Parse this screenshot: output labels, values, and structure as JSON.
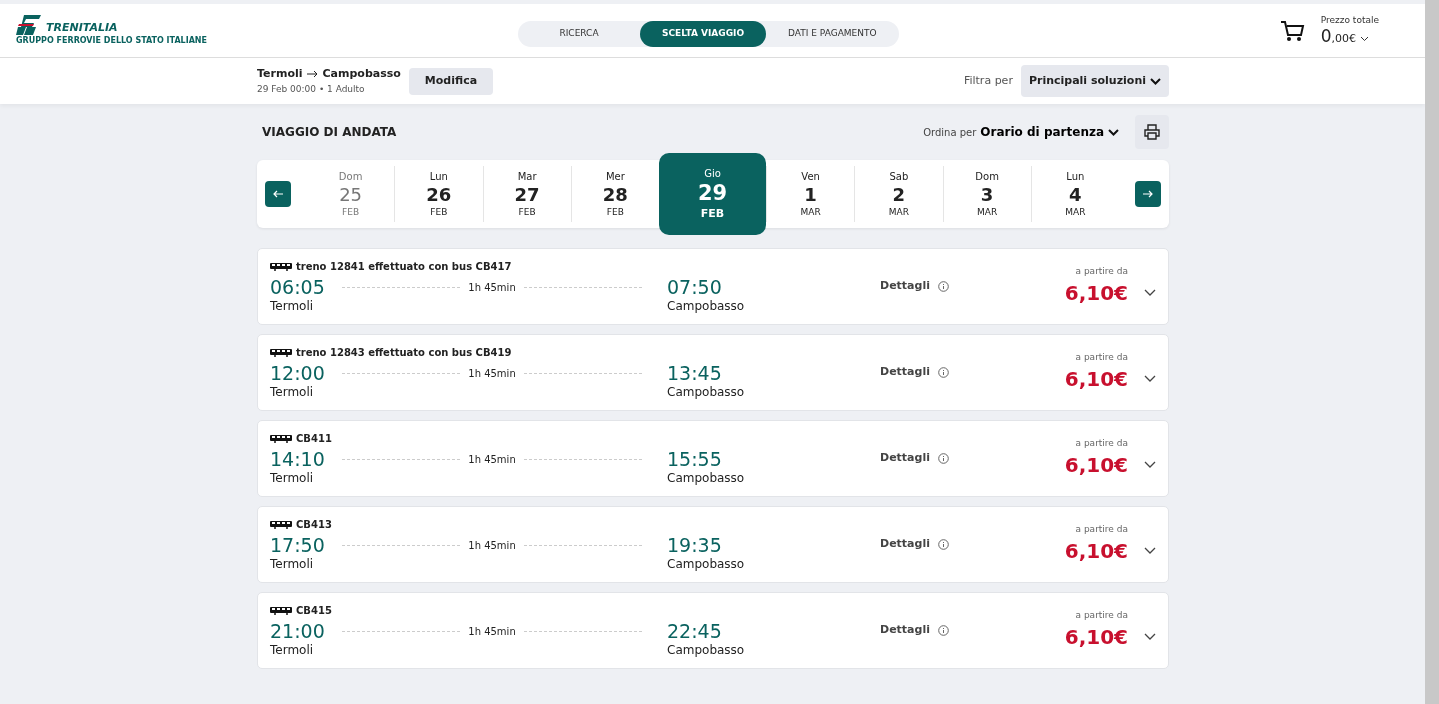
{
  "logo": {
    "name": "TRENITALIA",
    "tagline": "GRUPPO FERROVIE DELLO STATO ITALIANE"
  },
  "steps": [
    {
      "label": "RICERCA",
      "selected": false
    },
    {
      "label": "SCELTA VIAGGIO",
      "selected": true
    },
    {
      "label": "DATI E PAGAMENTO",
      "selected": false
    }
  ],
  "cart": {
    "label": "Prezzo totale",
    "amount_main": "0",
    "amount_cents": ",00€"
  },
  "search_summary": {
    "from": "Termoli",
    "to": "Campobasso",
    "details": "29 Feb 00:00 • 1 Adulto",
    "edit_button": "Modifica"
  },
  "filter": {
    "label": "Filtra per",
    "value": "Principali soluzioni"
  },
  "section_title": "VIAGGIO DI ANDATA",
  "sort": {
    "label": "Ordina per",
    "value": "Orario di partenza"
  },
  "days": [
    {
      "weekday": "Dom",
      "day": "25",
      "month": "FEB",
      "selected": false,
      "disabled": true
    },
    {
      "weekday": "Lun",
      "day": "26",
      "month": "FEB",
      "selected": false,
      "disabled": false
    },
    {
      "weekday": "Mar",
      "day": "27",
      "month": "FEB",
      "selected": false,
      "disabled": false
    },
    {
      "weekday": "Mer",
      "day": "28",
      "month": "FEB",
      "selected": false,
      "disabled": false
    },
    {
      "weekday": "Gio",
      "day": "29",
      "month": "FEB",
      "selected": true,
      "disabled": false
    },
    {
      "weekday": "Ven",
      "day": "1",
      "month": "MAR",
      "selected": false,
      "disabled": false
    },
    {
      "weekday": "Sab",
      "day": "2",
      "month": "MAR",
      "selected": false,
      "disabled": false
    },
    {
      "weekday": "Dom",
      "day": "3",
      "month": "MAR",
      "selected": false,
      "disabled": false
    },
    {
      "weekday": "Lun",
      "day": "4",
      "month": "MAR",
      "selected": false,
      "disabled": false
    }
  ],
  "solutions": [
    {
      "service": "treno 12841 effettuato con bus CB417",
      "departure": "06:05",
      "origin": "Termoli",
      "duration": "1h 45min",
      "arrival": "07:50",
      "destination": "Campobasso",
      "details": "Dettagli",
      "price_label": "a partire da",
      "price": "6,10€"
    },
    {
      "service": "treno 12843 effettuato con bus CB419",
      "departure": "12:00",
      "origin": "Termoli",
      "duration": "1h 45min",
      "arrival": "13:45",
      "destination": "Campobasso",
      "details": "Dettagli",
      "price_label": "a partire da",
      "price": "6,10€"
    },
    {
      "service": "CB411",
      "departure": "14:10",
      "origin": "Termoli",
      "duration": "1h 45min",
      "arrival": "15:55",
      "destination": "Campobasso",
      "details": "Dettagli",
      "price_label": "a partire da",
      "price": "6,10€"
    },
    {
      "service": "CB413",
      "departure": "17:50",
      "origin": "Termoli",
      "duration": "1h 45min",
      "arrival": "19:35",
      "destination": "Campobasso",
      "details": "Dettagli",
      "price_label": "a partire da",
      "price": "6,10€"
    },
    {
      "service": "CB415",
      "departure": "21:00",
      "origin": "Termoli",
      "duration": "1h 45min",
      "arrival": "22:45",
      "destination": "Campobasso",
      "details": "Dettagli",
      "price_label": "a partire da",
      "price": "6,10€"
    }
  ]
}
